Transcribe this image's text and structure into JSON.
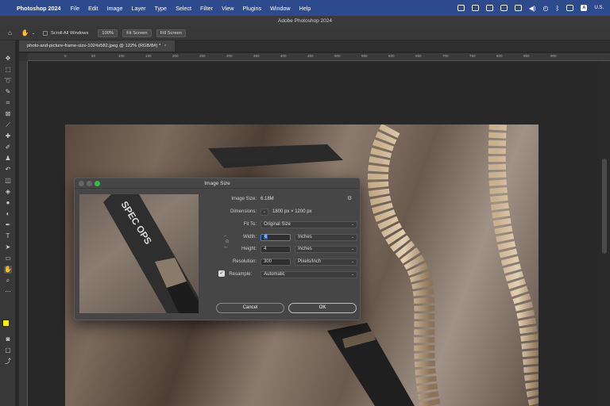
{
  "menubar": {
    "app": "Photoshop 2024",
    "items": [
      "File",
      "Edit",
      "Image",
      "Layer",
      "Type",
      "Select",
      "Filter",
      "View",
      "Plugins",
      "Window",
      "Help"
    ],
    "keyboard": "A",
    "keyboard_region": "U.S."
  },
  "titlebar": {
    "title": "Adobe Photoshop 2024"
  },
  "options": {
    "scroll_all_windows": "Scroll All Windows",
    "zoom_100": "100%",
    "fit_screen": "Fit Screen",
    "fill_screen": "Fill Screen"
  },
  "document": {
    "tab_label": "photo-and-picture-frame-size-1024x582.jpeg @ 122% (RGB/8#) *",
    "close": "×"
  },
  "ruler": {
    "ticks": [
      "0",
      "50",
      "100",
      "150",
      "200",
      "250",
      "300",
      "350",
      "400",
      "450",
      "500",
      "550",
      "600",
      "650",
      "700",
      "750",
      "800",
      "850",
      "900"
    ]
  },
  "dialog": {
    "title": "Image Size",
    "image_size_label": "Image Size:",
    "image_size_value": "6.18M",
    "dimensions_label": "Dimensions:",
    "dimensions_value": "1800 px  ×  1200 px",
    "fit_to_label": "Fit To:",
    "fit_to_value": "Original Size",
    "width_label": "Width:",
    "width_value": "6",
    "width_unit": "Inches",
    "height_label": "Height:",
    "height_value": "4",
    "height_unit": "Inches",
    "resolution_label": "Resolution:",
    "resolution_value": "300",
    "resolution_unit": "Pixels/Inch",
    "resample_label": "Resample:",
    "resample_value": "Automatic",
    "cancel": "Cancel",
    "ok": "OK",
    "preview_text": "SPEC OPS"
  },
  "colors": {
    "menubar": "#2d4a8c",
    "foreground": "#ffee00",
    "background": "#ffffff"
  }
}
